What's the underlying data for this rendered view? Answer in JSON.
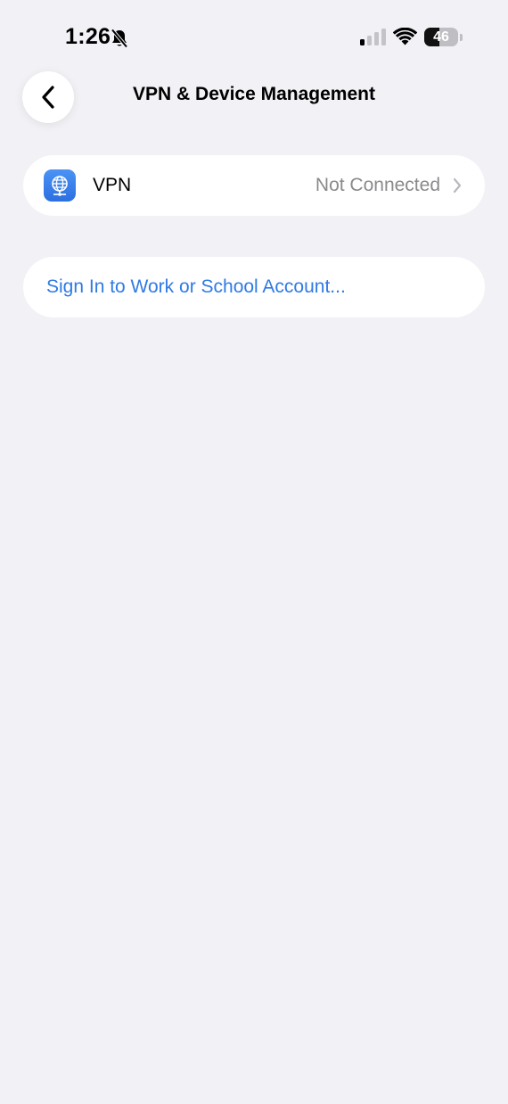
{
  "status_bar": {
    "time": "1:26",
    "battery_level": "46",
    "battery_fraction": 0.46
  },
  "nav": {
    "title": "VPN & Device Management"
  },
  "vpn_row": {
    "label": "VPN",
    "status": "Not Connected",
    "icon": "vpn-globe-icon"
  },
  "signin_row": {
    "label": "Sign In to Work or School Account..."
  },
  "colors": {
    "background": "#f1f1f6",
    "card": "#ffffff",
    "link": "#2f7ae5",
    "secondary_text": "#8a8a8e",
    "vpn_icon": "#3a82ec"
  }
}
